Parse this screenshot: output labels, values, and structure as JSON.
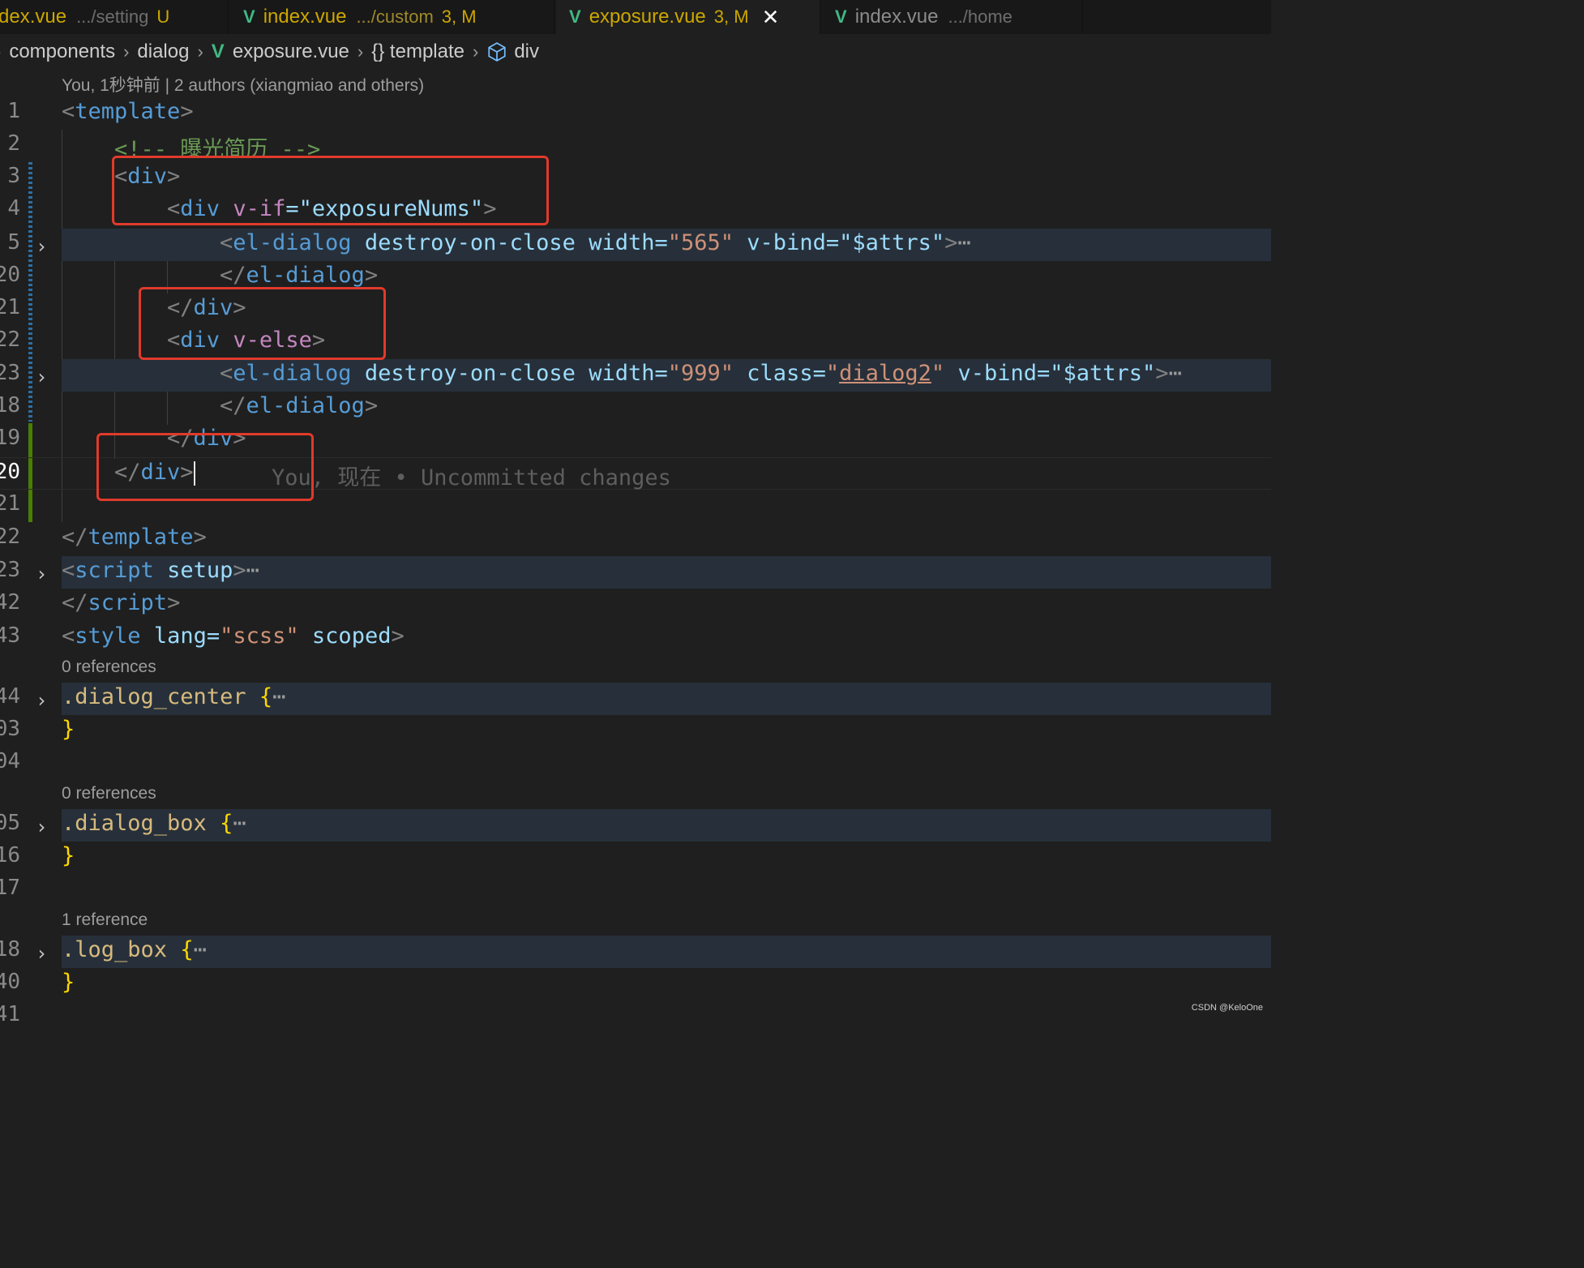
{
  "tabs": [
    {
      "name": "dex.vue",
      "path": ".../setting",
      "status": "U"
    },
    {
      "name": "index.vue",
      "path": ".../custom",
      "status": "3, M"
    },
    {
      "name": "exposure.vue",
      "status": "3, M",
      "close": "✕"
    },
    {
      "name": "index.vue",
      "path": ".../home"
    }
  ],
  "breadcrumb": [
    "components",
    "dialog",
    "exposure.vue",
    "{} template",
    "div"
  ],
  "codelens": {
    "blame": "You, 1秒钟前 | 2 authors (xiangmiao and others)",
    "ref0a": "0 references",
    "ref0b": "0 references",
    "ref1": "1 reference"
  },
  "line_numbers": [
    "1",
    "2",
    "3",
    "4",
    "5",
    "20",
    "21",
    "22",
    "23",
    "18",
    "19",
    "20",
    "21",
    "22",
    "23",
    "42",
    "43",
    "44",
    "03",
    "04",
    "05",
    "16",
    "17",
    "18",
    "40",
    "41"
  ],
  "code": {
    "l1_tag": "template",
    "l2_comment": "<!-- 曝光简历 -->",
    "div": "div",
    "v_if": "v-if",
    "v_if_val": "\"exposureNums\"",
    "el_dialog": "el-dialog",
    "destroy": "destroy-on-close",
    "width": "width",
    "w565": "\"565\"",
    "v_bind": "v-bind",
    "attrs": "\"$attrs\"",
    "ellipsis": "⋯",
    "v_else": "v-else",
    "w999": "\"999\"",
    "class": "class",
    "dialog2": "dialog2",
    "blame_inline": "You, 现在 • Uncommitted changes",
    "script": "script",
    "setup": "setup",
    "style": "style",
    "lang": "lang",
    "scss": "\"scss\"",
    "scoped": "scoped",
    "sel1": ".dialog_center",
    "sel2": ".dialog_box",
    "sel3": ".log_box",
    "open": "{",
    "close": "}"
  },
  "watermark": "CSDN @KeloOne",
  "colors": {
    "bg": "#1f1f1f",
    "tag": "#569cd6",
    "attr": "#9cdcfe",
    "string": "#ce9178",
    "annotation": "#e03a2b"
  }
}
